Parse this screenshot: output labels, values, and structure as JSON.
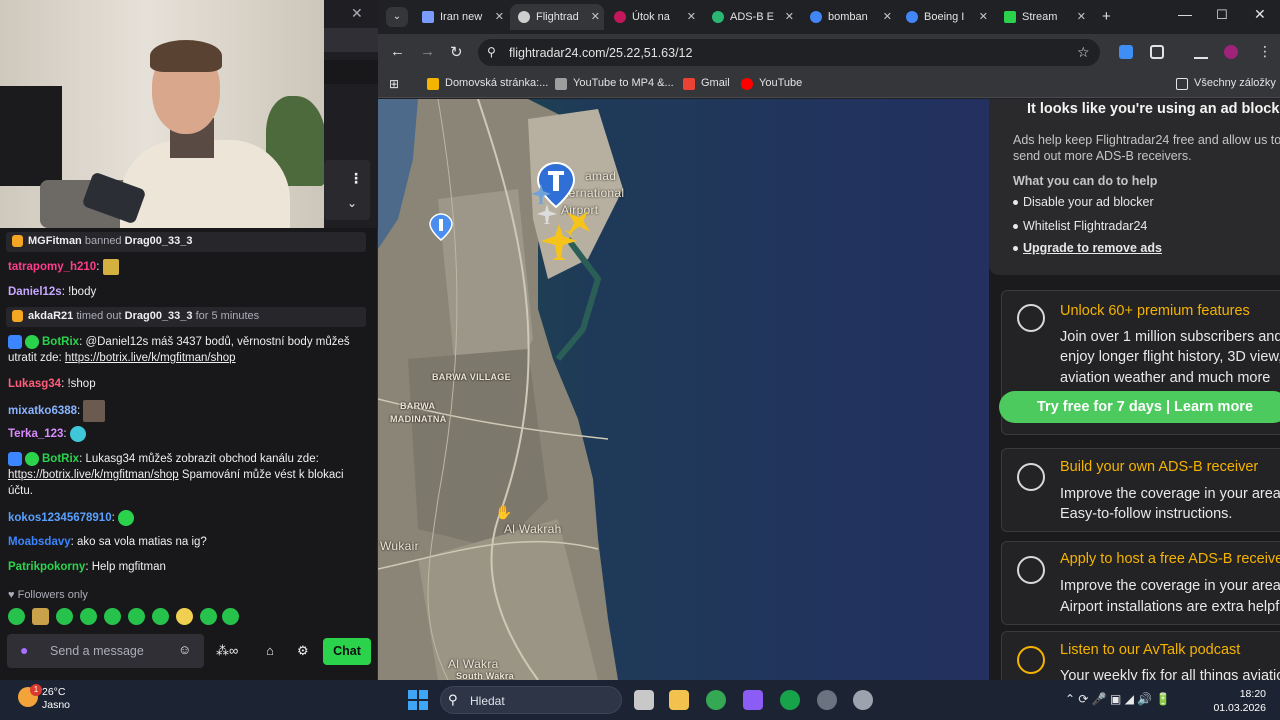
{
  "stream": {
    "chat": [
      {
        "type": "system",
        "user": "MGFitman",
        "action": "banned",
        "target": "Drag00_33_3",
        "icon_color": "#f5a623"
      },
      {
        "type": "msg",
        "user": "tatrapomy_h210",
        "user_color": "#ff3d8b",
        "text": ""
      },
      {
        "type": "msg",
        "user": "Daniel12s",
        "user_color": "#c8a8ff",
        "text": "!body"
      },
      {
        "type": "system",
        "user": "akdaR21",
        "action": "timed out",
        "target": "Drag00_33_3",
        "suffix": "for 5 minutes",
        "icon_color": "#f5a623"
      },
      {
        "type": "msg",
        "user": "BotRix",
        "user_color": "#2bd34d",
        "text": "@Daniel12s máš 3437 bodů, věrnostní body můžeš utratit zde:",
        "link": "https://botrix.live/k/mgfitman/shop"
      },
      {
        "type": "msg",
        "user": "Lukasg34",
        "user_color": "#ff5d7a",
        "text": "!shop"
      },
      {
        "type": "msg",
        "user": "mixatko6388",
        "user_color": "#8ab4ff",
        "text": ""
      },
      {
        "type": "msg",
        "user": "Terka_123",
        "user_color": "#d88cff",
        "text": ""
      },
      {
        "type": "msg",
        "user": "BotRix",
        "user_color": "#2bd34d",
        "text": "Lukasg34 můžeš zobrazit obchod kanálu zde:",
        "link": "https://botrix.live/k/mgfitman/shop",
        "text_after": "Spamování může vést k blokaci účtu."
      },
      {
        "type": "msg",
        "user": "kokos12345678910",
        "user_color": "#5aa0ff",
        "text": ""
      },
      {
        "type": "msg",
        "user": "Moabsdavy",
        "user_color": "#3b86ff",
        "text": "ako sa vola matias na ig?"
      },
      {
        "type": "msg",
        "user": "Patrikpokorny",
        "user_color": "#2bd34d",
        "text": "Help mgfitman"
      }
    ],
    "followers_only": "Followers only",
    "input_placeholder": "Send a message",
    "points_label": "∞",
    "chat_button": "Chat"
  },
  "browser": {
    "tabs": [
      {
        "label": "Iran new",
        "fav_color": "#7a9cff",
        "active": false
      },
      {
        "label": "Flightrad",
        "fav_color": "#cfcfcf",
        "active": true
      },
      {
        "label": "Útok na",
        "fav_color": "#c2185b",
        "active": false
      },
      {
        "label": "ADS-B E",
        "fav_color": "#2bb673",
        "active": false
      },
      {
        "label": "bomban",
        "fav_color": "#4285f4",
        "active": false
      },
      {
        "label": "Boeing I",
        "fav_color": "#4285f4",
        "active": false
      },
      {
        "label": "Stream",
        "fav_color": "#2bd34d",
        "active": false
      }
    ],
    "new_tab": "+",
    "url": "flightradar24.com/25.22,51.63/12",
    "bookmarks": [
      {
        "label": "Domovská stránka:...",
        "color": "#f4b400"
      },
      {
        "label": "YouTube to MP4 &...",
        "color": "#9e9e9e"
      },
      {
        "label": "Gmail",
        "color": "#ea4335"
      },
      {
        "label": "YouTube",
        "color": "#ff0000"
      }
    ],
    "all_bookmarks": "Všechny záložky"
  },
  "map": {
    "labels": [
      "amad",
      "ternational",
      "Airport",
      "BARWA VILLAGE",
      "BARWA",
      "MADINATNA",
      "Al Wakrah",
      "Wukair",
      "Al Wakra",
      "South Wakra"
    ]
  },
  "sidebar": {
    "ad_title": "It looks like you're using an ad blocker",
    "ad_text": "Ads help keep Flightradar24 free and allow us to send out more ADS-B receivers.",
    "ad_help": "What you can do to help",
    "ad_items": [
      "Disable your ad blocker",
      "Whitelist Flightradar24",
      "Upgrade to remove ads"
    ],
    "premium": {
      "title": "Unlock 60+ premium features",
      "body": [
        "Join over 1 million subscribers and",
        "enjoy longer flight history, 3D view,",
        "aviation weather and much more"
      ],
      "button": "Try free for 7 days | Learn more"
    },
    "build": {
      "title": "Build your own ADS-B receiver",
      "body": [
        "Improve the coverage in your area.",
        "Easy-to-follow instructions."
      ]
    },
    "host": {
      "title": "Apply to host a free ADS-B receiver",
      "body": [
        "Improve the coverage in your area.",
        "Airport installations are extra helpful."
      ]
    },
    "podcast": {
      "title": "Listen to our AvTalk podcast",
      "body": [
        "Your weekly fix for all things aviation"
      ]
    }
  },
  "taskbar": {
    "temp": "26°C",
    "condition": "Jasno",
    "weather_badge": "1",
    "search": "Hledat",
    "time": "18:20",
    "date": "01.03.2026"
  }
}
